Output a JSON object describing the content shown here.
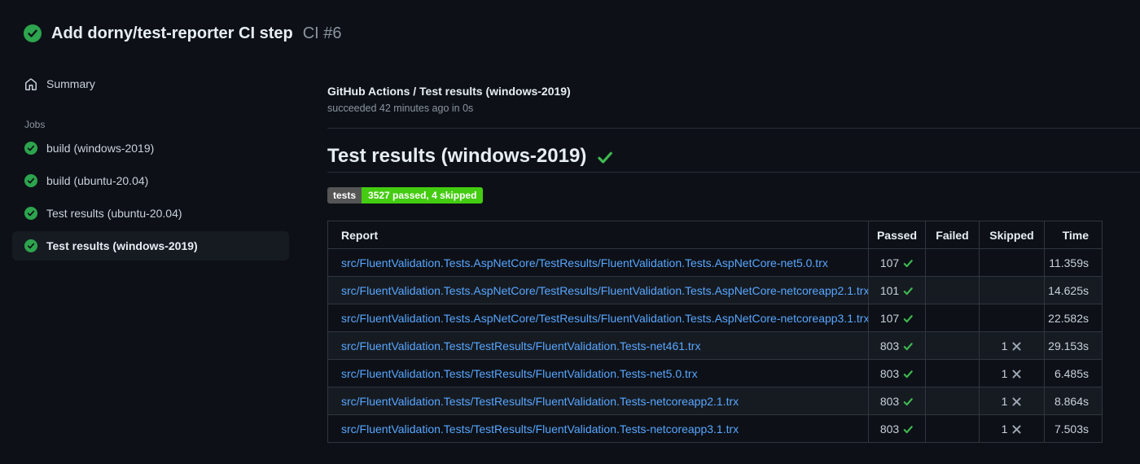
{
  "header": {
    "title": "Add dorny/test-reporter CI step",
    "run_number": "CI #6"
  },
  "sidebar": {
    "summary_label": "Summary",
    "jobs_label": "Jobs",
    "jobs": [
      {
        "label": "build (windows-2019)",
        "status": "success",
        "selected": false
      },
      {
        "label": "build (ubuntu-20.04)",
        "status": "success",
        "selected": false
      },
      {
        "label": "Test results (ubuntu-20.04)",
        "status": "success",
        "selected": false
      },
      {
        "label": "Test results (windows-2019)",
        "status": "success",
        "selected": true
      }
    ]
  },
  "main": {
    "breadcrumb_title": "GitHub Actions / Test results (windows-2019)",
    "status_line": "succeeded 42 minutes ago in 0s",
    "section_title": "Test results (windows-2019)",
    "badge": {
      "label": "tests",
      "value": "3527 passed, 4 skipped",
      "label_bg": "#555555",
      "value_bg": "#44cc11"
    },
    "table": {
      "columns": {
        "report": "Report",
        "passed": "Passed",
        "failed": "Failed",
        "skipped": "Skipped",
        "time": "Time"
      },
      "rows": [
        {
          "report": "src/FluentValidation.Tests.AspNetCore/TestResults/FluentValidation.Tests.AspNetCore-net5.0.trx",
          "passed": "107",
          "failed": "",
          "skipped": "",
          "time": "11.359s"
        },
        {
          "report": "src/FluentValidation.Tests.AspNetCore/TestResults/FluentValidation.Tests.AspNetCore-netcoreapp2.1.trx",
          "passed": "101",
          "failed": "",
          "skipped": "",
          "time": "14.625s"
        },
        {
          "report": "src/FluentValidation.Tests.AspNetCore/TestResults/FluentValidation.Tests.AspNetCore-netcoreapp3.1.trx",
          "passed": "107",
          "failed": "",
          "skipped": "",
          "time": "22.582s"
        },
        {
          "report": "src/FluentValidation.Tests/TestResults/FluentValidation.Tests-net461.trx",
          "passed": "803",
          "failed": "",
          "skipped": "1",
          "time": "29.153s"
        },
        {
          "report": "src/FluentValidation.Tests/TestResults/FluentValidation.Tests-net5.0.trx",
          "passed": "803",
          "failed": "",
          "skipped": "1",
          "time": "6.485s"
        },
        {
          "report": "src/FluentValidation.Tests/TestResults/FluentValidation.Tests-netcoreapp2.1.trx",
          "passed": "803",
          "failed": "",
          "skipped": "1",
          "time": "8.864s"
        },
        {
          "report": "src/FluentValidation.Tests/TestResults/FluentValidation.Tests-netcoreapp3.1.trx",
          "passed": "803",
          "failed": "",
          "skipped": "1",
          "time": "7.503s"
        }
      ]
    }
  },
  "colors": {
    "page_bg": "#0d1117",
    "row_alt_bg": "#161b22",
    "border": "#30363d",
    "success_circle": "#2da44e",
    "success_check": "#3fb950",
    "link": "#58a6ff",
    "muted_text": "#8b949e",
    "skipped_x": "#9ea7b3"
  }
}
